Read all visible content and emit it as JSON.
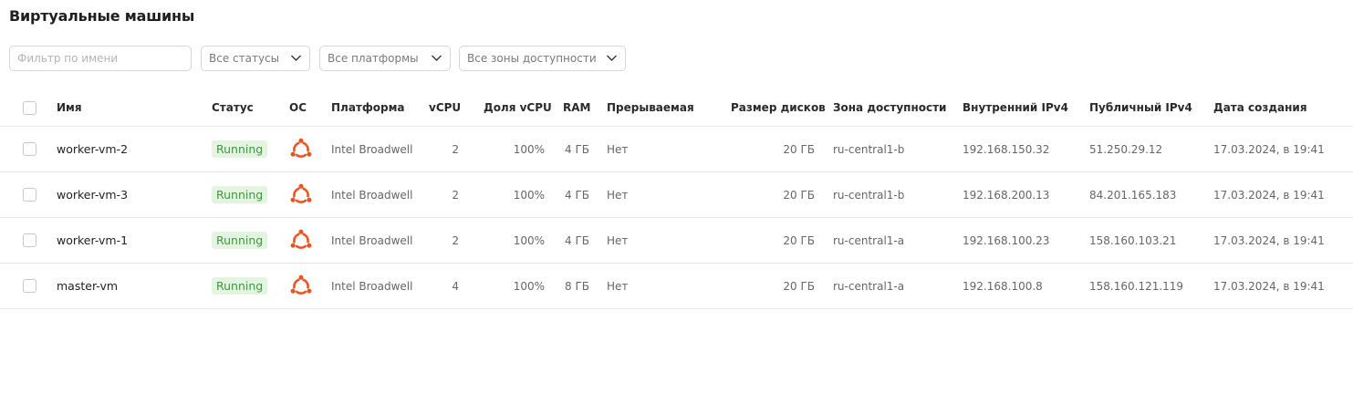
{
  "page": {
    "title": "Виртуальные машины"
  },
  "filters": {
    "name_placeholder": "Фильтр по имени",
    "status": "Все статусы",
    "platform": "Все платформы",
    "zone": "Все зоны доступности"
  },
  "table": {
    "headers": {
      "name": "Имя",
      "status": "Статус",
      "os": "ОС",
      "platform": "Платформа",
      "vcpu": "vCPU",
      "vcpu_share": "Доля vCPU",
      "ram": "RAM",
      "preemptible": "Прерываемая",
      "disk_size": "Размер дисков",
      "zone": "Зона доступности",
      "internal_ipv4": "Внутренний IPv4",
      "public_ipv4": "Публичный IPv4",
      "created": "Дата создания"
    },
    "rows": [
      {
        "name": "worker-vm-2",
        "status": "Running",
        "os_icon": "ubuntu-icon",
        "platform": "Intel Broadwell",
        "vcpu": "2",
        "vcpu_share": "100%",
        "ram": "4 ГБ",
        "preemptible": "Нет",
        "disk_size": "20 ГБ",
        "zone": "ru-central1-b",
        "internal_ipv4": "192.168.150.32",
        "public_ipv4": "51.250.29.12",
        "created": "17.03.2024, в 19:41"
      },
      {
        "name": "worker-vm-3",
        "status": "Running",
        "os_icon": "ubuntu-icon",
        "platform": "Intel Broadwell",
        "vcpu": "2",
        "vcpu_share": "100%",
        "ram": "4 ГБ",
        "preemptible": "Нет",
        "disk_size": "20 ГБ",
        "zone": "ru-central1-b",
        "internal_ipv4": "192.168.200.13",
        "public_ipv4": "84.201.165.183",
        "created": "17.03.2024, в 19:41"
      },
      {
        "name": "worker-vm-1",
        "status": "Running",
        "os_icon": "ubuntu-icon",
        "platform": "Intel Broadwell",
        "vcpu": "2",
        "vcpu_share": "100%",
        "ram": "4 ГБ",
        "preemptible": "Нет",
        "disk_size": "20 ГБ",
        "zone": "ru-central1-a",
        "internal_ipv4": "192.168.100.23",
        "public_ipv4": "158.160.103.21",
        "created": "17.03.2024, в 19:41"
      },
      {
        "name": "master-vm",
        "status": "Running",
        "os_icon": "ubuntu-icon",
        "platform": "Intel Broadwell",
        "vcpu": "4",
        "vcpu_share": "100%",
        "ram": "8 ГБ",
        "preemptible": "Нет",
        "disk_size": "20 ГБ",
        "zone": "ru-central1-a",
        "internal_ipv4": "192.168.100.8",
        "public_ipv4": "158.160.121.119",
        "created": "17.03.2024, в 19:41"
      }
    ]
  },
  "colors": {
    "running_badge_bg": "#e3f4e1",
    "running_badge_text": "#3c9a3c",
    "ubuntu_orange": "#e95420"
  }
}
